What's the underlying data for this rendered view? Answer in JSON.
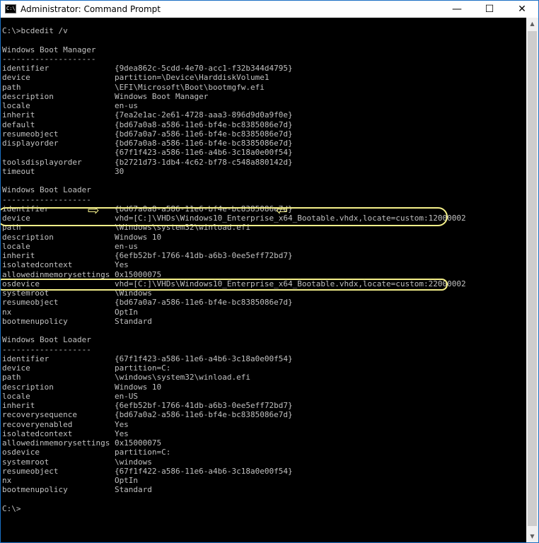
{
  "window": {
    "title": "Administrator: Command Prompt",
    "icon_text": "C:\\",
    "controls": {
      "minimize": "—",
      "maximize": "☐",
      "close": "✕"
    }
  },
  "console": {
    "lines": [
      "C:\\>bcdedit /v",
      "",
      "Windows Boot Manager",
      "--------------------",
      "identifier              {9dea862c-5cdd-4e70-acc1-f32b344d4795}",
      "device                  partition=\\Device\\HarddiskVolume1",
      "path                    \\EFI\\Microsoft\\Boot\\bootmgfw.efi",
      "description             Windows Boot Manager",
      "locale                  en-us",
      "inherit                 {7ea2e1ac-2e61-4728-aaa3-896d9d0a9f0e}",
      "default                 {bd67a0a8-a586-11e6-bf4e-bc8385086e7d}",
      "resumeobject            {bd67a0a7-a586-11e6-bf4e-bc8385086e7d}",
      "displayorder            {bd67a0a8-a586-11e6-bf4e-bc8385086e7d}",
      "                        {67f1f423-a586-11e6-a4b6-3c18a0e00f54}",
      "toolsdisplayorder       {b2721d73-1db4-4c62-bf78-c548a880142d}",
      "timeout                 30",
      "",
      "Windows Boot Loader",
      "-------------------",
      "identifier              {bd67a0a8-a586-11e6-bf4e-bc8385086e7d}",
      "device                  vhd=[C:]\\VHDs\\Windows10_Enterprise_x64_Bootable.vhdx,locate=custom:12000002",
      "path                    \\Windows\\system32\\winload.efi",
      "description             Windows 10",
      "locale                  en-us",
      "inherit                 {6efb52bf-1766-41db-a6b3-0ee5eff72bd7}",
      "isolatedcontext         Yes",
      "allowedinmemorysettings 0x15000075",
      "osdevice                vhd=[C:]\\VHDs\\Windows10_Enterprise_x64_Bootable.vhdx,locate=custom:22000002",
      "systemroot              \\Windows",
      "resumeobject            {bd67a0a7-a586-11e6-bf4e-bc8385086e7d}",
      "nx                      OptIn",
      "bootmenupolicy          Standard",
      "",
      "Windows Boot Loader",
      "-------------------",
      "identifier              {67f1f423-a586-11e6-a4b6-3c18a0e00f54}",
      "device                  partition=C:",
      "path                    \\windows\\system32\\winload.efi",
      "description             Windows 10",
      "locale                  en-US",
      "inherit                 {6efb52bf-1766-41db-a6b3-0ee5eff72bd7}",
      "recoverysequence        {bd67a0a2-a586-11e6-bf4e-bc8385086e7d}",
      "recoveryenabled         Yes",
      "isolatedcontext         Yes",
      "allowedinmemorysettings 0x15000075",
      "osdevice                partition=C:",
      "systemroot              \\windows",
      "resumeobject            {67f1f422-a586-11e6-a4b6-3c18a0e00f54}",
      "nx                      OptIn",
      "bootmenupolicy          Standard",
      "",
      "C:\\>"
    ]
  },
  "colors": {
    "console_bg": "#000000",
    "console_text": "#c0c0c0",
    "annotation": "#f5f08a",
    "title_bg": "#ffffff"
  }
}
